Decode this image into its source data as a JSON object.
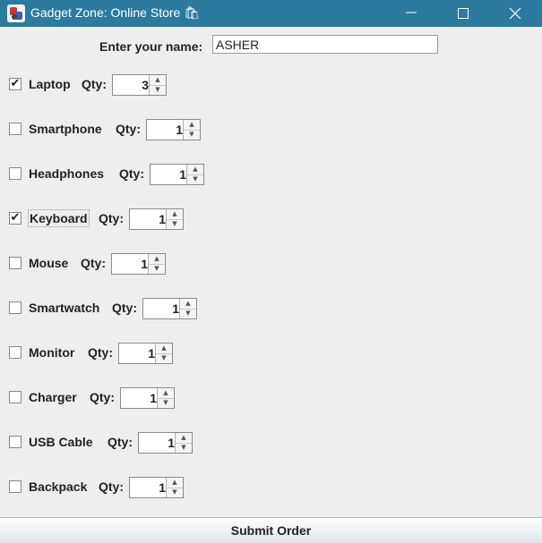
{
  "window": {
    "title": "Gadget Zone: Online Store 🛍"
  },
  "name_field": {
    "label": "Enter your name:",
    "value": "ASHER"
  },
  "qty_label": "Qty:",
  "products": [
    {
      "label": "Laptop",
      "checked": "✔",
      "qty": "3"
    },
    {
      "label": "Smartphone",
      "checked": "",
      "qty": "1"
    },
    {
      "label": "Headphones",
      "checked": "",
      "qty": "1"
    },
    {
      "label": "Keyboard",
      "checked": "✔",
      "qty": "1"
    },
    {
      "label": "Mouse",
      "checked": "",
      "qty": "1"
    },
    {
      "label": "Smartwatch",
      "checked": "",
      "qty": "1"
    },
    {
      "label": "Monitor",
      "checked": "",
      "qty": "1"
    },
    {
      "label": "Charger",
      "checked": "",
      "qty": "1"
    },
    {
      "label": "USB Cable",
      "checked": "",
      "qty": "1"
    },
    {
      "label": "Backpack",
      "checked": "",
      "qty": "1"
    }
  ],
  "submit_label": "Submit Order",
  "icons": {
    "app": "app-icon",
    "minimize": "minimize-icon",
    "maximize": "maximize-icon",
    "close": "close-icon",
    "spin_up": "spinner-up-icon",
    "spin_down": "spinner-down-icon",
    "check": "checkmark-icon"
  }
}
